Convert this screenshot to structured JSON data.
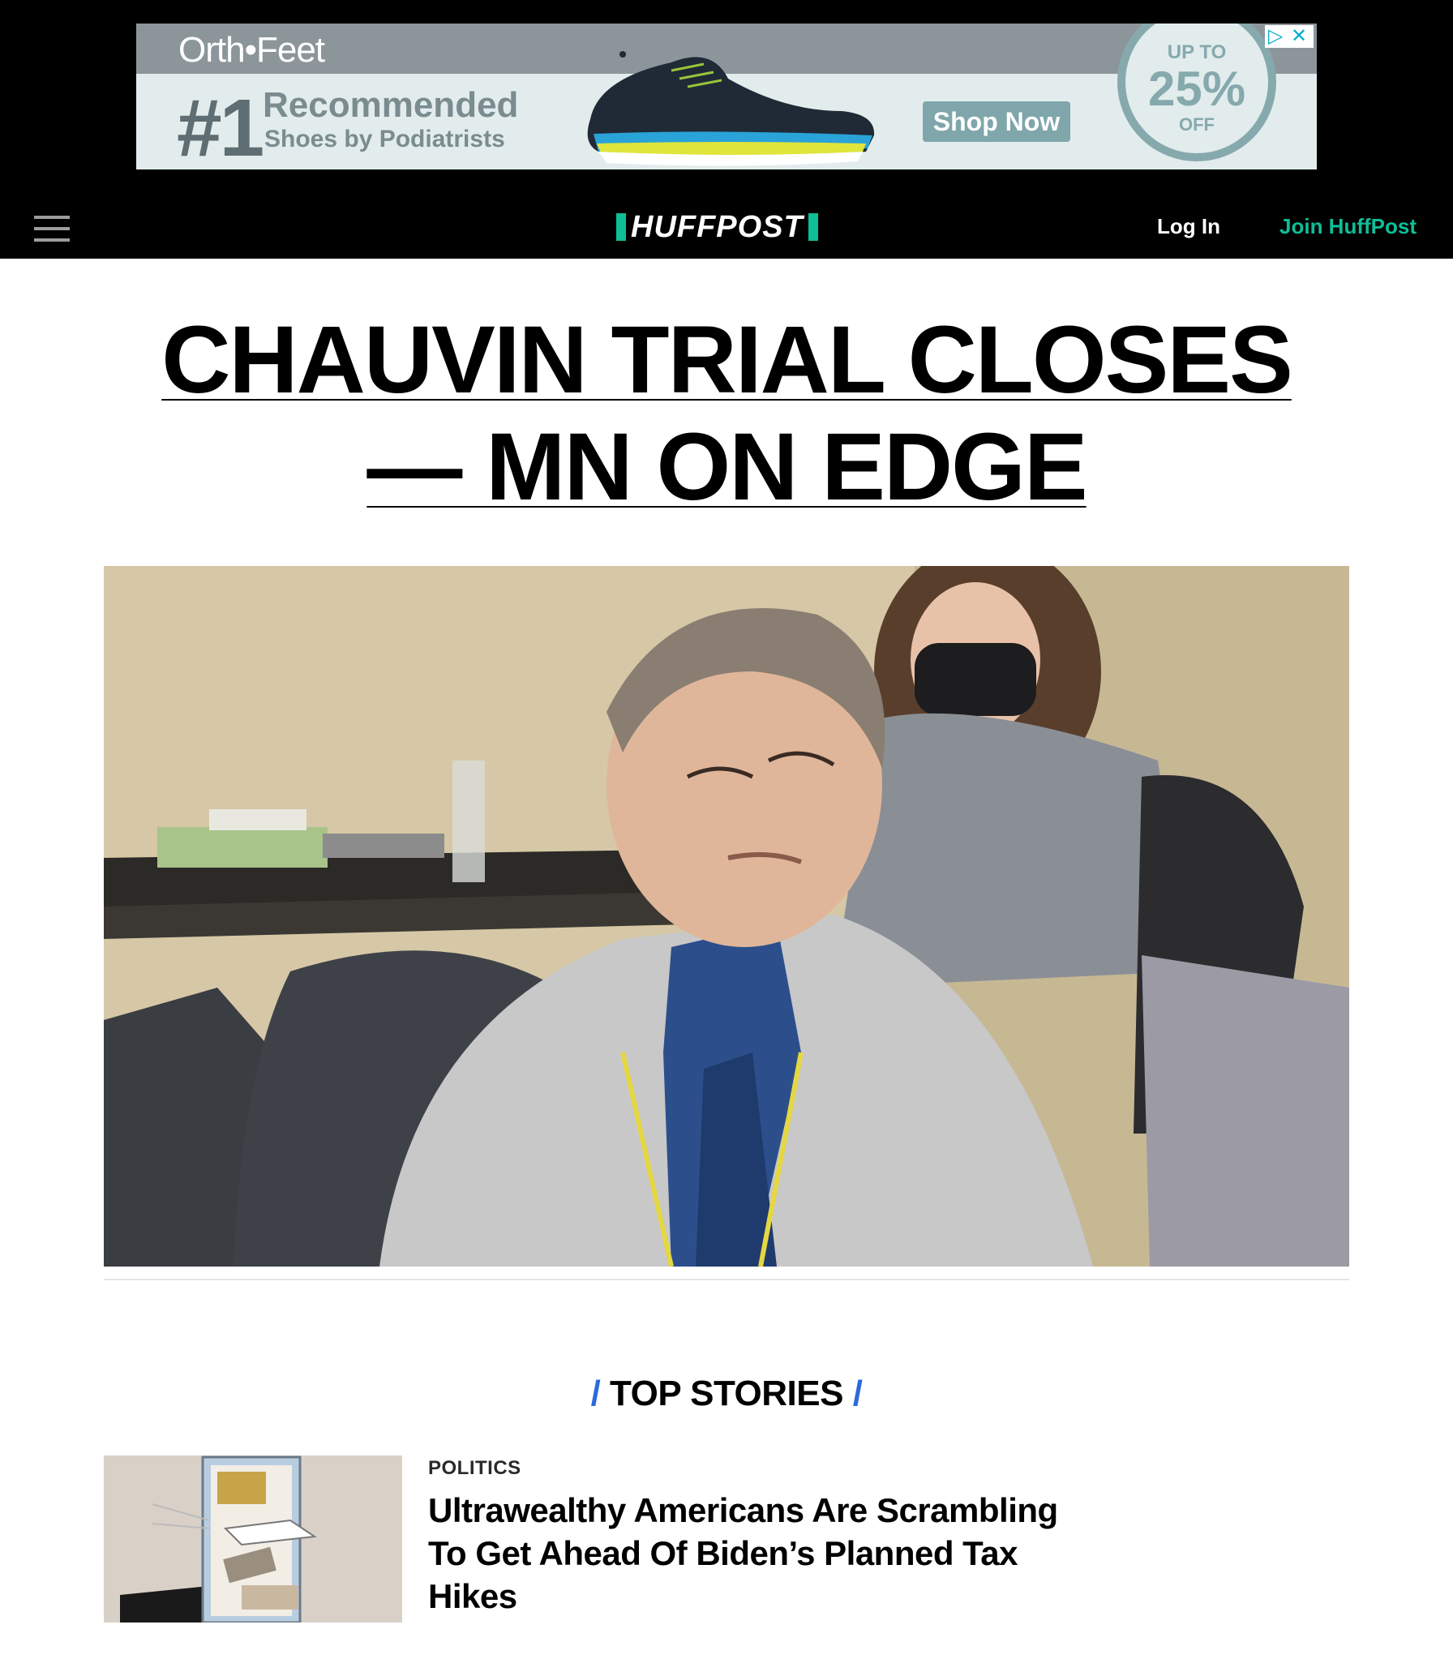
{
  "ad": {
    "brand": "Orth•Feet",
    "rank": "#1",
    "headline": "Recommended",
    "subline": "Shoes by Podiatrists",
    "cta": "Shop Now",
    "badge_top": "UP TO",
    "badge_value": "25%",
    "badge_bottom": "OFF",
    "colors": {
      "panel": "#e2ecec",
      "band": "#8c969a",
      "accent": "#86a9ad"
    }
  },
  "header": {
    "menu_icon": "hamburger-menu-icon",
    "logo": "HUFFPOST",
    "login_label": "Log In",
    "join_label": "Join HuffPost",
    "colors": {
      "background": "#000000",
      "brand": "#0dbe98"
    }
  },
  "article": {
    "headline_line1": "CHAUVIN TRIAL CLOSES",
    "headline_line2": "— MN ON EDGE"
  },
  "top_stories": {
    "heading": "TOP STORIES",
    "items": [
      {
        "category": "POLITICS",
        "title": "Ultrawealthy Americans Are Scrambling To Get Ahead Of Biden’s Planned Tax Hikes"
      }
    ]
  }
}
